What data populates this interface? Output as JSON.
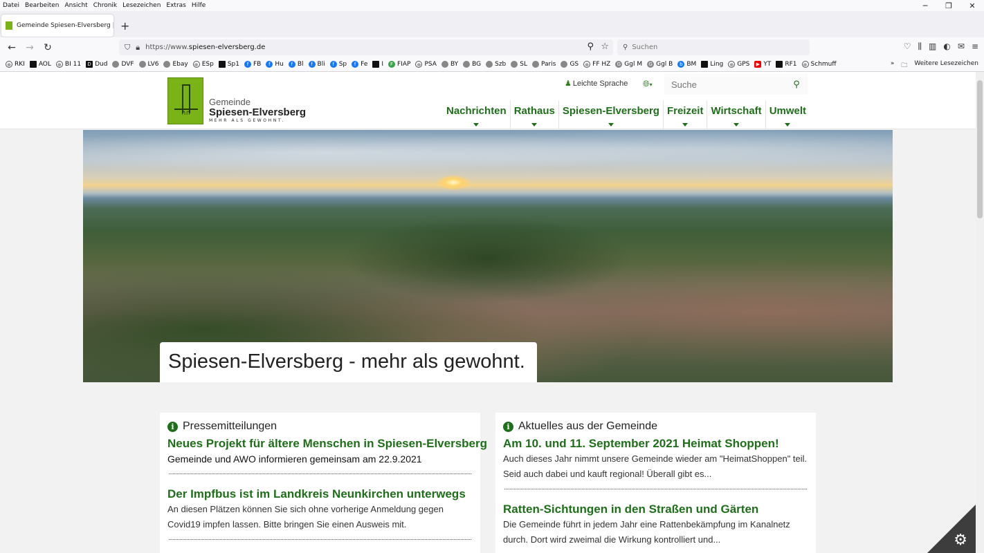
{
  "menubar": [
    "Datei",
    "Bearbeiten",
    "Ansicht",
    "Chronik",
    "Lesezeichen",
    "Extras",
    "Hilfe"
  ],
  "window_controls": [
    "─",
    "❐",
    "✕"
  ],
  "tab": {
    "title": "Gemeinde Spiesen-Elversberg |",
    "close": "✕"
  },
  "newtab": "+",
  "nav": {
    "back": "←",
    "forward": "→",
    "reload": "↻"
  },
  "url": {
    "prefix": "https://www.",
    "domain": "spiesen-elversberg.de"
  },
  "browser_search": {
    "placeholder": "Suchen"
  },
  "bookmarks": [
    {
      "label": "RKI",
      "icon": "globe"
    },
    {
      "label": "AOL",
      "icon": "aol"
    },
    {
      "label": "BI 11",
      "icon": "globe"
    },
    {
      "label": "Dud",
      "icon": "d"
    },
    {
      "label": "DVF",
      "icon": "dvf"
    },
    {
      "label": "LV6",
      "icon": "dvf"
    },
    {
      "label": "Ebay",
      "icon": "bag"
    },
    {
      "label": "ESp",
      "icon": "globe"
    },
    {
      "label": "Sp1",
      "icon": "black"
    },
    {
      "label": "FB",
      "icon": "facebook"
    },
    {
      "label": "Hu",
      "icon": "facebook"
    },
    {
      "label": "Bl",
      "icon": "facebook"
    },
    {
      "label": "Bli",
      "icon": "facebook"
    },
    {
      "label": "Sp",
      "icon": "facebook"
    },
    {
      "label": "Fe",
      "icon": "facebook"
    },
    {
      "label": "I",
      "icon": "black"
    },
    {
      "label": "FIAP",
      "icon": "green"
    },
    {
      "label": "PSA",
      "icon": "globe"
    },
    {
      "label": "BY",
      "icon": "car"
    },
    {
      "label": "BG",
      "icon": "car"
    },
    {
      "label": "Szb",
      "icon": "car"
    },
    {
      "label": "SL",
      "icon": "car"
    },
    {
      "label": "Paris",
      "icon": "car"
    },
    {
      "label": "GS",
      "icon": "car"
    },
    {
      "label": "FF HZ",
      "icon": "globe"
    },
    {
      "label": "Ggl M",
      "icon": "google"
    },
    {
      "label": "Ggl B",
      "icon": "google"
    },
    {
      "label": "BM",
      "icon": "b"
    },
    {
      "label": "Ling",
      "icon": "black"
    },
    {
      "label": "GPS",
      "icon": "globe"
    },
    {
      "label": "YT",
      "icon": "youtube"
    },
    {
      "label": "RF1",
      "icon": "black"
    },
    {
      "label": "Schmuff",
      "icon": "globe"
    }
  ],
  "bookmarks_more": "»",
  "bookmarks_folder": "Weitere Lesezeichen",
  "site": {
    "logo": {
      "line1": "Gemeinde",
      "line2": "Spiesen-Elversberg",
      "tagline": "MEHR ALS GEWOHNT."
    },
    "leichte_sprache": "Leichte Sprache",
    "lang_icon": "globe-icon",
    "search_placeholder": "Suche",
    "nav": [
      "Nachrichten",
      "Rathaus",
      "Spiesen-Elversberg",
      "Freizeit",
      "Wirtschaft",
      "Umwelt"
    ],
    "hero_caption": "Spiesen-Elversberg - mehr als gewohnt."
  },
  "cards": {
    "left": {
      "title": "Pressemitteilungen",
      "items": [
        {
          "heading": "Neues Projekt für ältere Menschen in Spiesen-Elversberg",
          "text": "Gemeinde und AWO informieren gemeinsam am 22.9.2021"
        },
        {
          "heading": "Der Impfbus ist im Landkreis Neunkirchen unterwegs",
          "text": "An diesen Plätzen können Sie sich ohne vorherige Anmeldung gegen Covid19 impfen lassen. Bitte bringen Sie einen Ausweis mit."
        }
      ]
    },
    "right": {
      "title": "Aktuelles aus der Gemeinde",
      "items": [
        {
          "heading": "Am 10. und 11. September 2021 Heimat Shoppen!",
          "text": "Auch dieses Jahr nimmt unsere Gemeinde wieder am \"HeimatShoppen\" teil. Seid auch dabei und kauft regional! Überall gibt es..."
        },
        {
          "heading": "Ratten-Sichtungen in den Straßen und Gärten",
          "text": "Die Gemeinde führt in jedem Jahr eine Rattenbekämpfung im Kanalnetz durch. Dort wird zweimal die Wirkung kontrolliert und..."
        }
      ]
    }
  },
  "colors": {
    "brand_green": "#1f6e1a",
    "logo_green": "#7ab317"
  }
}
